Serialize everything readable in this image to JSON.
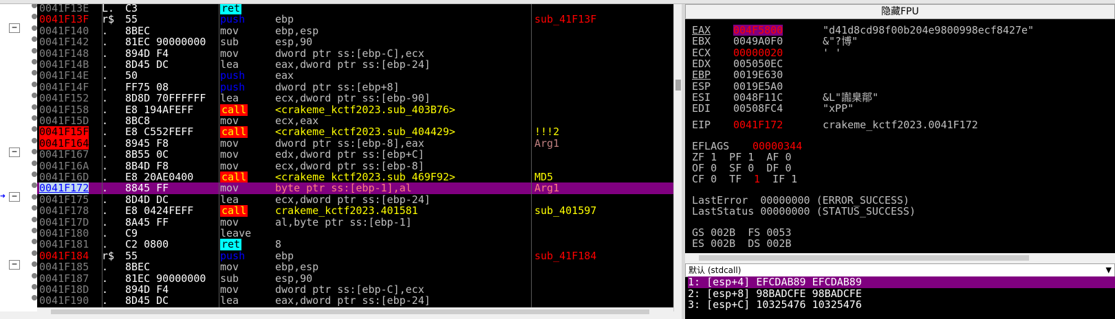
{
  "disasm": {
    "rows": [
      {
        "addr": "0041F13E",
        "tree": "L.",
        "bytes": "C3",
        "mn": "ret",
        "ops": "",
        "cmt": ""
      },
      {
        "addr": "0041F13F",
        "tree": "r$",
        "bytes": "55",
        "mn": "push",
        "ops": "ebp",
        "cmt": "sub_41F13F"
      },
      {
        "addr": "0041F140",
        "tree": ".",
        "bytes": "8BEC",
        "mn": "mov",
        "ops": "ebp,esp",
        "cmt": ""
      },
      {
        "addr": "0041F142",
        "tree": ".",
        "bytes": "81EC 90000000",
        "mn": "sub",
        "ops": "esp,90",
        "cmt": ""
      },
      {
        "addr": "0041F148",
        "tree": ".",
        "bytes": "894D F4",
        "mn": "mov",
        "ops": "dword ptr ss:[ebp-C],ecx",
        "cmt": ""
      },
      {
        "addr": "0041F14B",
        "tree": ".",
        "bytes": "8D45 DC",
        "mn": "lea",
        "ops": "eax,dword ptr ss:[ebp-24]",
        "cmt": ""
      },
      {
        "addr": "0041F14E",
        "tree": ".",
        "bytes": "50",
        "mn": "push",
        "ops": "eax",
        "cmt": ""
      },
      {
        "addr": "0041F14F",
        "tree": ".",
        "bytes": "FF75 08",
        "mn": "push",
        "ops": "dword ptr ss:[ebp+8]",
        "cmt": ""
      },
      {
        "addr": "0041F152",
        "tree": ".",
        "bytes": "8D8D 70FFFFFF",
        "mn": "lea",
        "ops": "ecx,dword ptr ss:[ebp-90]",
        "cmt": ""
      },
      {
        "addr": "0041F158",
        "tree": ".",
        "bytes": "E8 194AFEFF",
        "mn": "call",
        "ops": "<crakeme_kctf2023.sub_403B76>",
        "cmt": ""
      },
      {
        "addr": "0041F15D",
        "tree": ".",
        "bytes": "8BC8",
        "mn": "mov",
        "ops": "ecx,eax",
        "cmt": ""
      },
      {
        "addr": "0041F15F",
        "tree": ".",
        "bytes": "E8 C552FEFF",
        "mn": "call",
        "ops": "<crakeme_kctf2023.sub_404429>",
        "cmt": "!!!2"
      },
      {
        "addr": "0041F164",
        "tree": ".",
        "bytes": "8945 F8",
        "mn": "mov",
        "ops": "dword ptr ss:[ebp-8],eax",
        "cmt": "Arg1"
      },
      {
        "addr": "0041F167",
        "tree": ".",
        "bytes": "8B55 0C",
        "mn": "mov",
        "ops": "edx,dword ptr ss:[ebp+C]",
        "cmt": ""
      },
      {
        "addr": "0041F16A",
        "tree": ".",
        "bytes": "8B4D F8",
        "mn": "mov",
        "ops": "ecx,dword ptr ss:[ebp-8]",
        "cmt": ""
      },
      {
        "addr": "0041F16D",
        "tree": ".",
        "bytes": "E8 20AE0400",
        "mn": "call",
        "ops": "<crakeme_kctf2023.sub_469F92>",
        "cmt": "MD5"
      },
      {
        "addr": "0041F172",
        "tree": ".",
        "bytes": "8845 FF",
        "mn": "mov",
        "ops": "byte ptr ss:[ebp-1],al",
        "cmt": "Arg1"
      },
      {
        "addr": "0041F175",
        "tree": ".",
        "bytes": "8D4D DC",
        "mn": "lea",
        "ops": "ecx,dword ptr ss:[ebp-24]",
        "cmt": ""
      },
      {
        "addr": "0041F178",
        "tree": ".",
        "bytes": "E8 0424FEFF",
        "mn": "call",
        "ops": "crakeme_kctf2023.401581",
        "cmt": "sub_401597"
      },
      {
        "addr": "0041F17D",
        "tree": ".",
        "bytes": "8A45 FF",
        "mn": "mov",
        "ops": "al,byte ptr ss:[ebp-1]",
        "cmt": ""
      },
      {
        "addr": "0041F180",
        "tree": ".",
        "bytes": "C9",
        "mn": "leave",
        "ops": "",
        "cmt": ""
      },
      {
        "addr": "0041F181",
        "tree": ".",
        "bytes": "C2 0800",
        "mn": "ret",
        "ops": "8",
        "cmt": ""
      },
      {
        "addr": "0041F184",
        "tree": "r$",
        "bytes": "55",
        "mn": "push",
        "ops": "ebp",
        "cmt": "sub_41F184"
      },
      {
        "addr": "0041F185",
        "tree": ".",
        "bytes": "8BEC",
        "mn": "mov",
        "ops": "ebp,esp",
        "cmt": ""
      },
      {
        "addr": "0041F187",
        "tree": ".",
        "bytes": "81EC 90000000",
        "mn": "sub",
        "ops": "esp,90",
        "cmt": ""
      },
      {
        "addr": "0041F18D",
        "tree": ".",
        "bytes": "894D F4",
        "mn": "mov",
        "ops": "dword ptr ss:[ebp-C],ecx",
        "cmt": ""
      },
      {
        "addr": "0041F190",
        "tree": ".",
        "bytes": "8D45 DC",
        "mn": "lea",
        "ops": "eax,dword ptr ss:[ebp-24]",
        "cmt": ""
      }
    ]
  },
  "registers": {
    "header": "隐藏FPU",
    "regs": [
      {
        "name": "EAX",
        "val": "004F5800",
        "cmt": "\"d41d8cd98f00b204e9800998ecf8427e\""
      },
      {
        "name": "EBX",
        "val": "0049A0F0",
        "cmt": "&\"?博\""
      },
      {
        "name": "ECX",
        "val": "00000020",
        "cmt": "' '"
      },
      {
        "name": "EDX",
        "val": "005050EC",
        "cmt": ""
      },
      {
        "name": "EBP",
        "val": "0019E630",
        "cmt": ""
      },
      {
        "name": "ESP",
        "val": "0019E5A0",
        "cmt": ""
      },
      {
        "name": "ESI",
        "val": "0048F11C",
        "cmt": "&L\"讟臬鄁\""
      },
      {
        "name": "EDI",
        "val": "00508FC4",
        "cmt": "\"xPP\""
      }
    ],
    "eip": {
      "name": "EIP",
      "val": "0041F172",
      "cmt": "crakeme_kctf2023.0041F172"
    },
    "eflags_label": "EFLAGS",
    "eflags_val": "00000344",
    "flags_line1": "ZF 1  PF 1  AF 0",
    "flags_line2": "OF 0  SF 0  DF 0",
    "flags_line3_a": "CF 0  TF ",
    "flags_line3_tf": "1",
    "flags_line3_b": "  IF 1",
    "lasterror": "LastError  00000000 (ERROR_SUCCESS)",
    "laststatus": "LastStatus 00000000 (STATUS_SUCCESS)",
    "seg1": "GS 002B  FS 0053",
    "seg2": "ES 002B  DS 002B"
  },
  "callconv": {
    "label": "默认 (stdcall)",
    "dropdown": "▼"
  },
  "stack": [
    "1: [esp+4] EFCDAB89 EFCDAB89",
    "2: [esp+8] 98BADCFE 98BADCFE",
    "3: [esp+C] 10325476 10325476"
  ],
  "colors": {
    "selection": "#800080",
    "call_bg": "#ff0000",
    "ret_bg": "#00ffff",
    "breakpoint": "#ff0000"
  }
}
